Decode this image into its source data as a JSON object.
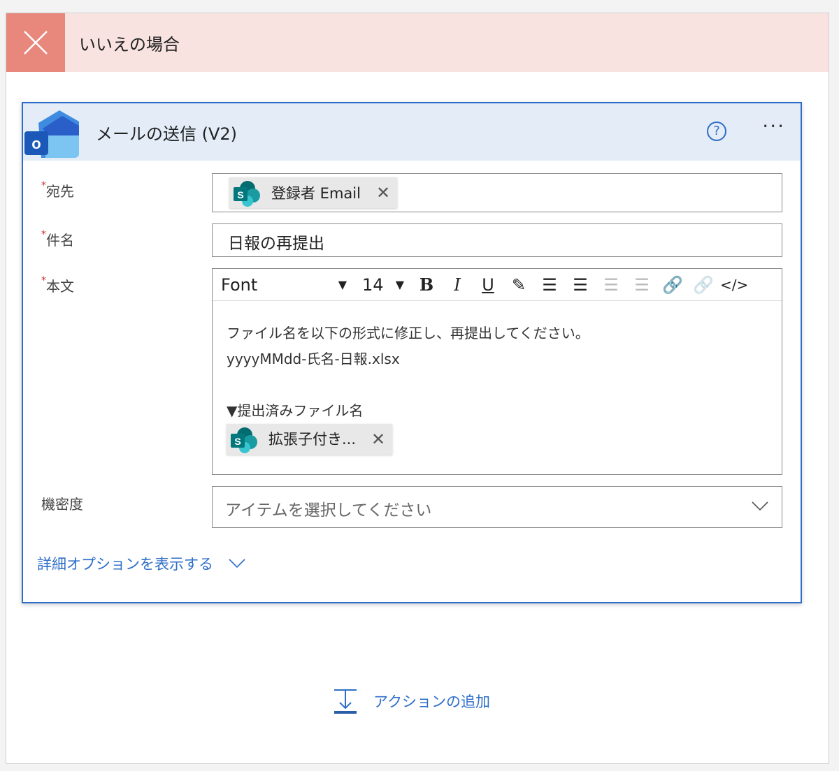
{
  "branch": {
    "title": "いいえの場合"
  },
  "action": {
    "title": "メールの送信 (V2)",
    "help": "?",
    "more": "···"
  },
  "fields": {
    "to": {
      "label": "宛先",
      "token": "登録者 Email"
    },
    "subject": {
      "label": "件名",
      "value": "日報の再提出"
    },
    "body": {
      "label": "本文",
      "font": "Font",
      "size": "14",
      "lines": [
        "ファイル名を以下の形式に修正し、再提出してください。",
        "yyyyMMdd-氏名-日報.xlsx",
        "",
        "▼提出済みファイル名"
      ],
      "token": "拡張子付き..."
    },
    "sensitivity": {
      "label": "機密度",
      "placeholder": "アイテムを選択してください"
    }
  },
  "required_mark": "*",
  "advanced_link": "詳細オプションを表示する",
  "add_action": "アクションの追加"
}
